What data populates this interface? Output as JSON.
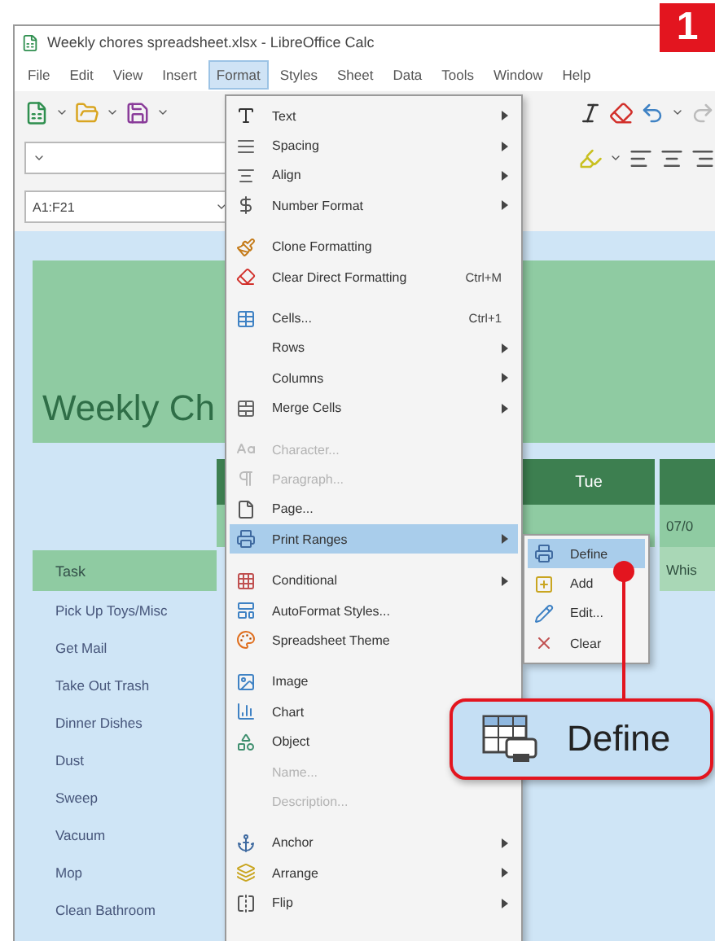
{
  "window": {
    "title": "Weekly chores spreadsheet.xlsx - LibreOffice Calc"
  },
  "step_badge": "1",
  "menubar": [
    {
      "label": "File",
      "selected": false
    },
    {
      "label": "Edit",
      "selected": false
    },
    {
      "label": "View",
      "selected": false
    },
    {
      "label": "Insert",
      "selected": false
    },
    {
      "label": "Format",
      "selected": true
    },
    {
      "label": "Styles",
      "selected": false
    },
    {
      "label": "Sheet",
      "selected": false
    },
    {
      "label": "Data",
      "selected": false
    },
    {
      "label": "Tools",
      "selected": false
    },
    {
      "label": "Window",
      "selected": false
    },
    {
      "label": "Help",
      "selected": false
    }
  ],
  "name_box": {
    "value": "A1:F21"
  },
  "format_menu": [
    {
      "kind": "item",
      "label": "Text",
      "submenu": true,
      "disabled": false,
      "selected": false
    },
    {
      "kind": "item",
      "label": "Spacing",
      "submenu": true,
      "disabled": false,
      "selected": false
    },
    {
      "kind": "item",
      "label": "Align",
      "submenu": true,
      "disabled": false,
      "selected": false
    },
    {
      "kind": "item",
      "label": "Number Format",
      "submenu": true,
      "disabled": false,
      "selected": false
    },
    {
      "kind": "separator"
    },
    {
      "kind": "item",
      "label": "Clone Formatting",
      "submenu": false,
      "disabled": false,
      "selected": false
    },
    {
      "kind": "item",
      "label": "Clear Direct Formatting",
      "shortcut": "Ctrl+M",
      "submenu": false,
      "disabled": false,
      "selected": false
    },
    {
      "kind": "separator"
    },
    {
      "kind": "item",
      "label": "Cells...",
      "shortcut": "Ctrl+1",
      "submenu": false,
      "disabled": false,
      "selected": false
    },
    {
      "kind": "item",
      "label": "Rows",
      "submenu": true,
      "disabled": false,
      "selected": false
    },
    {
      "kind": "item",
      "label": "Columns",
      "submenu": true,
      "disabled": false,
      "selected": false
    },
    {
      "kind": "item",
      "label": "Merge Cells",
      "submenu": true,
      "disabled": false,
      "selected": false
    },
    {
      "kind": "separator"
    },
    {
      "kind": "item",
      "label": "Character...",
      "submenu": false,
      "disabled": true,
      "selected": false
    },
    {
      "kind": "item",
      "label": "Paragraph...",
      "submenu": false,
      "disabled": true,
      "selected": false
    },
    {
      "kind": "item",
      "label": "Page...",
      "submenu": false,
      "disabled": false,
      "selected": false
    },
    {
      "kind": "item",
      "label": "Print Ranges",
      "submenu": true,
      "disabled": false,
      "selected": true
    },
    {
      "kind": "separator"
    },
    {
      "kind": "item",
      "label": "Conditional",
      "submenu": true,
      "disabled": false,
      "selected": false
    },
    {
      "kind": "item",
      "label": "AutoFormat Styles...",
      "submenu": false,
      "disabled": false,
      "selected": false
    },
    {
      "kind": "item",
      "label": "Spreadsheet Theme",
      "submenu": false,
      "disabled": false,
      "selected": false
    },
    {
      "kind": "separator"
    },
    {
      "kind": "item",
      "label": "Image",
      "submenu": false,
      "disabled": false,
      "selected": false
    },
    {
      "kind": "item",
      "label": "Chart",
      "submenu": false,
      "disabled": false,
      "selected": false
    },
    {
      "kind": "item",
      "label": "Object",
      "submenu": false,
      "disabled": false,
      "selected": false
    },
    {
      "kind": "item",
      "label": "Name...",
      "submenu": false,
      "disabled": true,
      "selected": false
    },
    {
      "kind": "item",
      "label": "Description...",
      "submenu": false,
      "disabled": true,
      "selected": false
    },
    {
      "kind": "separator"
    },
    {
      "kind": "item",
      "label": "Anchor",
      "submenu": true,
      "disabled": false,
      "selected": false
    },
    {
      "kind": "item",
      "label": "Arrange",
      "submenu": true,
      "disabled": false,
      "selected": false
    },
    {
      "kind": "item",
      "label": "Flip",
      "submenu": true,
      "disabled": false,
      "selected": false
    }
  ],
  "print_ranges_menu": [
    {
      "label": "Define",
      "selected": true
    },
    {
      "label": "Add",
      "selected": false
    },
    {
      "label": "Edit...",
      "selected": false
    },
    {
      "label": "Clear",
      "selected": false
    }
  ],
  "callout": {
    "label": "Define"
  },
  "sheet": {
    "title": "Weekly Ch",
    "day_header": "Tue",
    "next_date": "07/0",
    "next_cell": "Whis",
    "task_header": "Task",
    "tasks": [
      "Pick Up Toys/Misc",
      "Get Mail",
      "Take Out Trash",
      "Dinner Dishes",
      "Dust",
      "Sweep",
      "Vacuum",
      "Mop",
      "Clean Bathroom"
    ]
  }
}
